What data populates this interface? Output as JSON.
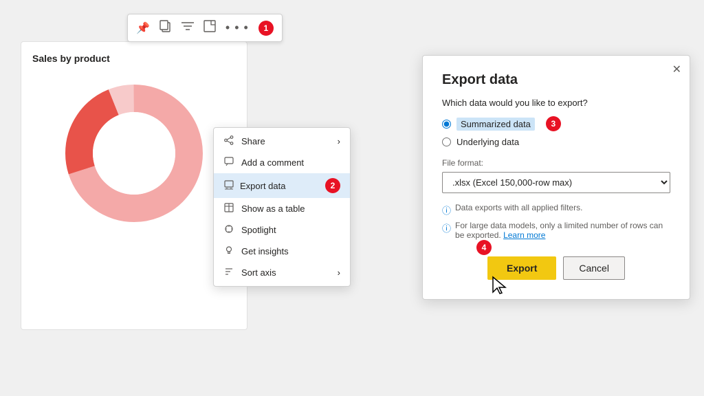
{
  "chart": {
    "title": "Sales by product",
    "panel": {
      "bg": "#ffffff"
    }
  },
  "toolbar": {
    "badge": "1",
    "pin_icon": "📌",
    "copy_icon": "⧉",
    "filter_icon": "≡",
    "expand_icon": "⤢",
    "dots": "• • •"
  },
  "context_menu": {
    "badge": "2",
    "items": [
      {
        "id": "share",
        "icon": "share",
        "label": "Share",
        "has_arrow": true
      },
      {
        "id": "add-comment",
        "icon": "comment",
        "label": "Add a comment",
        "has_arrow": false
      },
      {
        "id": "export-data",
        "icon": "export",
        "label": "Export data",
        "has_arrow": false,
        "active": true
      },
      {
        "id": "show-as-table",
        "icon": "table",
        "label": "Show as a table",
        "has_arrow": false
      },
      {
        "id": "spotlight",
        "icon": "spotlight",
        "label": "Spotlight",
        "has_arrow": false
      },
      {
        "id": "get-insights",
        "icon": "insights",
        "label": "Get insights",
        "has_arrow": false
      },
      {
        "id": "sort-axis",
        "icon": "sort",
        "label": "Sort axis",
        "has_arrow": true
      }
    ]
  },
  "dialog": {
    "title": "Export data",
    "question": "Which data would you like to export?",
    "badge": "3",
    "radio_options": [
      {
        "id": "summarized",
        "label": "Summarized data",
        "selected": true
      },
      {
        "id": "underlying",
        "label": "Underlying data",
        "selected": false
      }
    ],
    "file_format_label": "File format:",
    "file_format_value": ".xlsx (Excel 150,000-row max)",
    "info_lines": [
      {
        "text": "Data exports with all applied filters."
      },
      {
        "text": "For large data models, only a limited number of rows can be exported. "
      }
    ],
    "learn_more": "Learn more",
    "buttons": {
      "export_label": "Export",
      "cancel_label": "Cancel",
      "badge": "4"
    }
  }
}
